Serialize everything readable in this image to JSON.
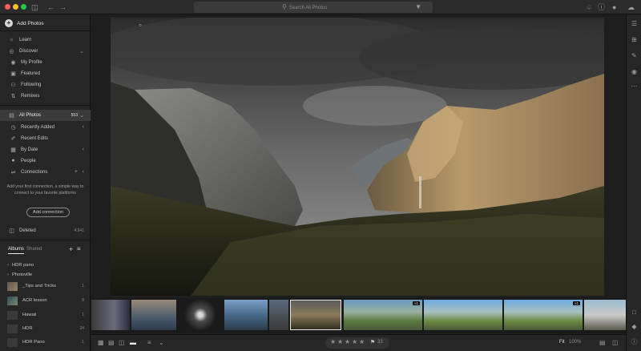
{
  "search": {
    "placeholder": "Search All Photos"
  },
  "sidebar": {
    "add_photos": "Add Photos",
    "learn": "Learn",
    "discover": "Discover",
    "discover_items": [
      "My Profile",
      "Featured",
      "Following",
      "Remixes"
    ],
    "all_photos": {
      "label": "All Photos",
      "count": "553"
    },
    "photo_items": [
      "Recently Added",
      "Recent Edits",
      "By Date",
      "People",
      "Connections"
    ],
    "connections_message": "Add your first connection, a simple way to connect to your favorite platforms",
    "add_connection": "Add connection",
    "deleted": {
      "label": "Deleted",
      "count": "4,941"
    }
  },
  "albums": {
    "tab_albums": "Albums",
    "tab_shared": "Shared",
    "items": [
      {
        "label": "HDR pano",
        "count": ""
      },
      {
        "label": "Photoville",
        "count": ""
      },
      {
        "label": "_Tips and Tricks",
        "count": "1"
      },
      {
        "label": "ACR lesson",
        "count": "8"
      },
      {
        "label": "Hawaii",
        "count": "1"
      },
      {
        "label": "HDR",
        "count": "24"
      },
      {
        "label": "HDR Pano",
        "count": "1"
      }
    ]
  },
  "filmstrip": {
    "badges": [
      "x1",
      "x1"
    ]
  },
  "bottombar": {
    "flag_count": "33",
    "fit_label": "Fit",
    "zoom_label": "100%"
  },
  "icons": {
    "add": "plus-icon",
    "learn": "lightbulb-icon",
    "discover": "compass-icon",
    "profile": "profile-icon",
    "featured": "featured-icon",
    "following": "people-icon",
    "remixes": "remix-icon",
    "all_photos": "photos-icon",
    "recent_added": "clock-icon",
    "recent_edits": "edit-icon",
    "by_date": "calendar-icon",
    "people": "person-icon",
    "connections": "share-icon",
    "deleted": "trash-icon"
  }
}
